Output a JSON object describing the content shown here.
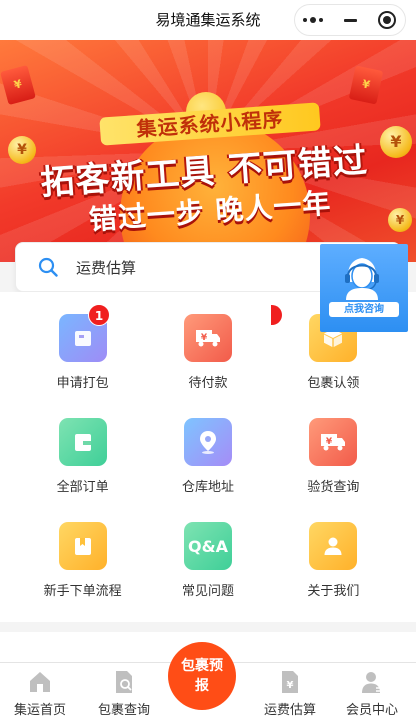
{
  "window": {
    "title": "易境通集运系统"
  },
  "banner": {
    "subtitle": "集运系统小程序",
    "headline": "拓客新工具 不可错过",
    "tagline": "错过一步 晚人一年"
  },
  "search": {
    "text": "运费估算"
  },
  "grid": [
    {
      "label": "申请打包",
      "badge": "1"
    },
    {
      "label": "待付款"
    },
    {
      "label": "包裹认领"
    },
    {
      "label": "全部订单"
    },
    {
      "label": "仓库地址"
    },
    {
      "label": "验货查询"
    },
    {
      "label": "新手下单流程"
    },
    {
      "label": "常见问题",
      "icon_text": "Q&A"
    },
    {
      "label": "关于我们"
    }
  ],
  "service": {
    "label": "点我咨询"
  },
  "tabbar": {
    "items": [
      {
        "label": "集运首页"
      },
      {
        "label": "包裹查询"
      },
      {
        "label": "运费估算"
      },
      {
        "label": "会员中心"
      }
    ],
    "center_label": "包裹预报"
  },
  "colors": {
    "accent": "#ff4d16",
    "badge": "#f01f1f",
    "service": "#2d8ff2"
  }
}
